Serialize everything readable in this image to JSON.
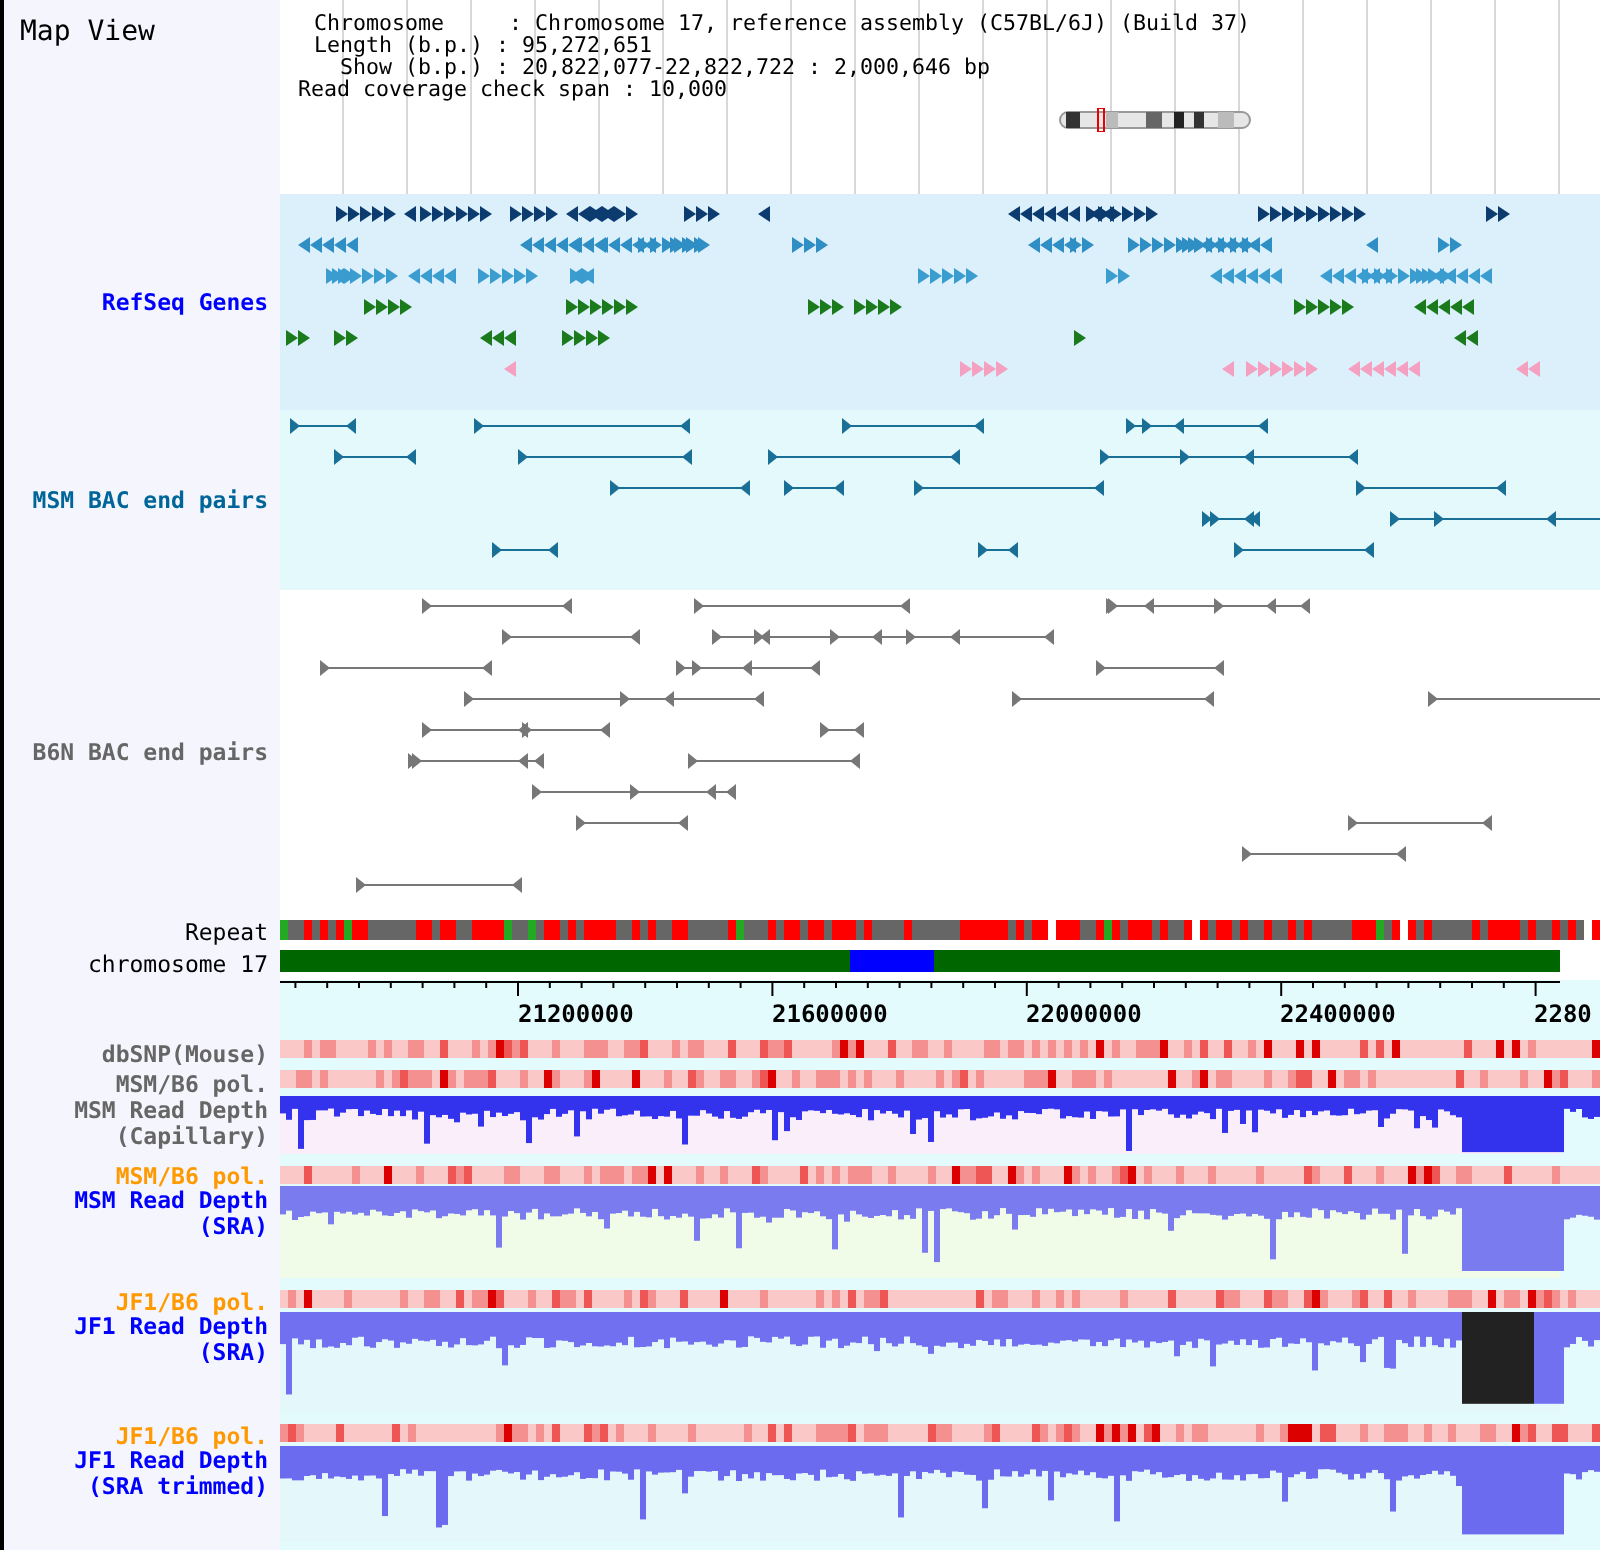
{
  "title": "Map View",
  "info": {
    "rows": [
      "Chromosome     : Chromosome 17, reference assembly (C57BL/6J) (Build 37)",
      "Length (b.p.) : 95,272,651",
      "  Show (b.p.) : 20,822,077-22,822,722 : 2,000,646 bp"
    ],
    "span": "Read coverage check span : 10,000"
  },
  "tracks": [
    {
      "kind": "genes",
      "label": "RefSeq Genes",
      "color": "#0000ff"
    },
    {
      "kind": "pairs",
      "label": "MSM BAC end pairs",
      "color": "#006699"
    },
    {
      "kind": "pairs",
      "label": "B6N BAC end pairs",
      "color": "#666666"
    },
    {
      "kind": "repeat",
      "label": "Repeat",
      "color": "#000000"
    },
    {
      "kind": "chromosome",
      "label": "chromosome 17",
      "color": "#000000"
    },
    {
      "kind": "axis",
      "labels": [
        "21200000",
        "21600000",
        "22000000",
        "22400000",
        "2280"
      ]
    },
    {
      "kind": "strip",
      "label": "dbSNP(Mouse)",
      "color": "#666666"
    },
    {
      "kind": "strip",
      "label": "MSM/B6 pol.",
      "color": "#666666"
    },
    {
      "kind": "depth",
      "label": "MSM Read Depth (Capillary)",
      "color": "#666666"
    },
    {
      "kind": "strip",
      "label": "MSM/B6 pol.",
      "color": "#ff9900"
    },
    {
      "kind": "depth",
      "label": "MSM Read Depth (SRA)",
      "color": "#0000ff"
    },
    {
      "kind": "strip",
      "label": "JF1/B6 pol.",
      "color": "#ff9900"
    },
    {
      "kind": "depth",
      "label": "JF1 Read Depth (SRA)",
      "color": "#0000ff"
    },
    {
      "kind": "strip",
      "label": "JF1/B6 pol.",
      "color": "#ff9900"
    },
    {
      "kind": "depth",
      "label": "JF1 Read Depth (SRA trimmed)",
      "color": "#0000ff"
    }
  ]
}
